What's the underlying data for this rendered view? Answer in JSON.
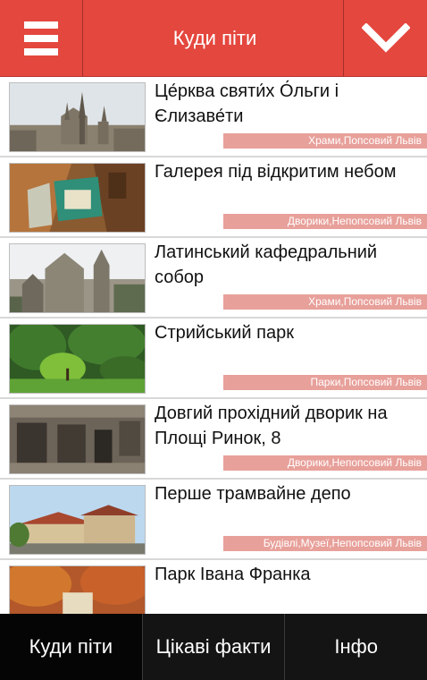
{
  "header": {
    "title": "Куди піти",
    "menu_icon": "hamburger-icon",
    "dropdown_icon": "chevron-down-icon",
    "accent": "#e4473e"
  },
  "places": [
    {
      "title": "Це́рква святи́х О́льги і Єлизаве́ти",
      "tags": "Храми,Попсовий Львів"
    },
    {
      "title": "Галерея під відкритим небом",
      "tags": "Дворики,Непопсовий Львів"
    },
    {
      "title": "Латинський кафедральний собор",
      "tags": "Храми,Попсовий Львів"
    },
    {
      "title": "Стрийський парк",
      "tags": "Парки,Попсовий Львів"
    },
    {
      "title": "Довгий прохідний дворик на Площі Ринок, 8",
      "tags": "Дворики,Непопсовий Львів"
    },
    {
      "title": "Перше трамвайне депо",
      "tags": "Будівлі,Музеї,Непопсовий Львів"
    },
    {
      "title": "Парк Івана Франка",
      "tags": ""
    }
  ],
  "tabs": [
    {
      "label": "Куди піти",
      "active": true
    },
    {
      "label": "Цікаві факти",
      "active": false
    },
    {
      "label": "Інфо",
      "active": false
    }
  ]
}
